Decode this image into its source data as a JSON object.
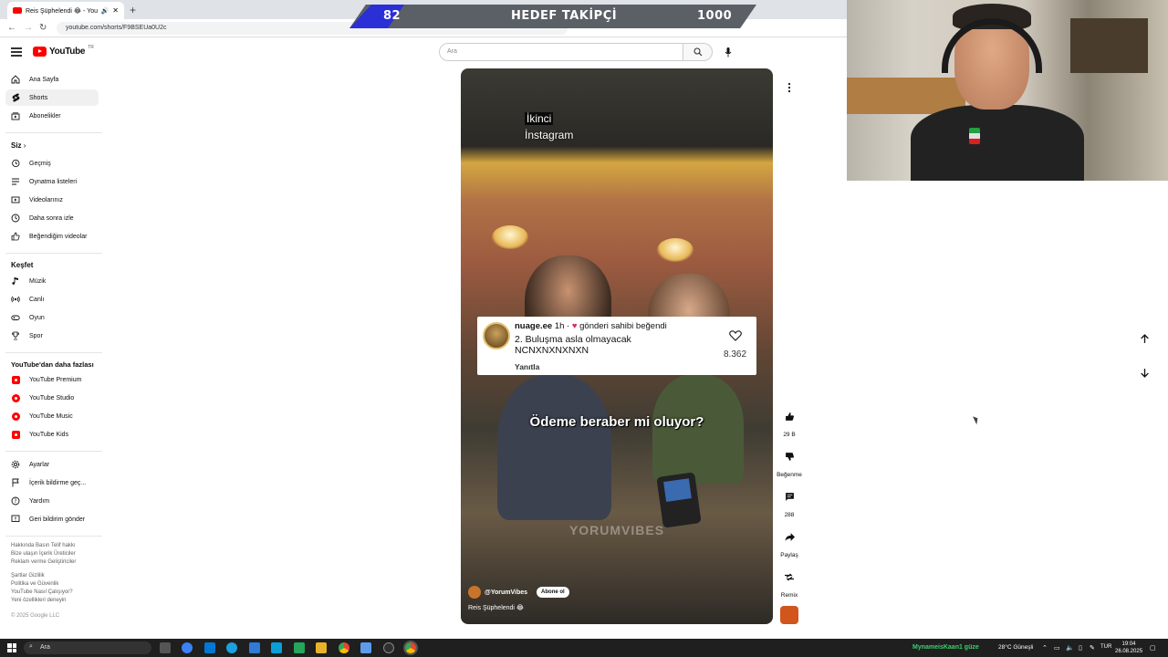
{
  "browser": {
    "tab_title": "Reis Şüphelendi 😂 - YouTube",
    "url": "youtube.com/shorts/F9BSEUa0U2c",
    "new_tab": "+"
  },
  "overlay": {
    "current": "82",
    "label": "HEDEF TAKİPÇİ",
    "target": "1000"
  },
  "header": {
    "logo_text": "YouTube",
    "region": "TR",
    "search_placeholder": "Ara"
  },
  "sidebar": {
    "main": [
      {
        "label": "Ana Sayfa",
        "icon": "home-icon"
      },
      {
        "label": "Shorts",
        "icon": "shorts-icon"
      },
      {
        "label": "Abonelikler",
        "icon": "subscriptions-icon"
      }
    ],
    "you_heading": "Siz",
    "you": [
      {
        "label": "Geçmiş",
        "icon": "history-icon"
      },
      {
        "label": "Oynatma listeleri",
        "icon": "playlist-icon"
      },
      {
        "label": "Videolarınız",
        "icon": "your-videos-icon"
      },
      {
        "label": "Daha sonra izle",
        "icon": "watch-later-icon"
      },
      {
        "label": "Beğendiğim videolar",
        "icon": "liked-icon"
      }
    ],
    "explore_heading": "Keşfet",
    "explore": [
      {
        "label": "Müzik",
        "icon": "music-icon"
      },
      {
        "label": "Canlı",
        "icon": "live-icon"
      },
      {
        "label": "Oyun",
        "icon": "gaming-icon"
      },
      {
        "label": "Spor",
        "icon": "sports-icon"
      }
    ],
    "more_heading": "YouTube'dan daha fazlası",
    "more": [
      {
        "label": "YouTube Premium"
      },
      {
        "label": "YouTube Studio"
      },
      {
        "label": "YouTube Music"
      },
      {
        "label": "YouTube Kids"
      }
    ],
    "settings": [
      {
        "label": "Ayarlar",
        "icon": "settings-icon"
      },
      {
        "label": "İçerik bildirme geç...",
        "icon": "flag-icon"
      },
      {
        "label": "Yardım",
        "icon": "help-icon"
      },
      {
        "label": "Geri bildirim gönder",
        "icon": "feedback-icon"
      }
    ],
    "footer1": "Hakkında  Basın  Telif hakkı\nBize ulaşın  İçerik Üreticiler\nReklam verme  Geliştiriciler",
    "footer2": "Şartlar  Gizlilik\nPolitika ve Güvenlik\nYouTube Nasıl Çalışıyor?\nYeni özellikleri deneyin",
    "copyright": "© 2025 Google LLC"
  },
  "video": {
    "top_caption_1": "İkinci",
    "top_caption_2": "İnstagram",
    "comment": {
      "user": "nuage.ee",
      "time": "1h",
      "liked_by": "gönderi sahibi beğendi",
      "text": "2. Buluşma asla olmayacak NCNXNXNXNXN",
      "reply": "Yanıtla",
      "likes": "8.362"
    },
    "mid_caption": "Ödeme beraber mi oluyor?",
    "watermark": "YORUMVIBES",
    "channel": "@YorumVibes",
    "subscribe": "Abone ol",
    "title": "Reis Şüphelendi 😂"
  },
  "actions": {
    "like_count": "29 B",
    "dislike": "Beğenme",
    "comments": "288",
    "share": "Paylaş",
    "remix": "Remix"
  },
  "taskbar": {
    "search": "Ara",
    "user": "MynameisKaan1 güze",
    "temp": "28°C",
    "weather": "Güneşli",
    "lang": "TUR",
    "time": "19:04",
    "date": "26.08.2025"
  },
  "colors": {
    "youtube_red": "#ff0000",
    "overlay_blue": "#2b2fd6",
    "overlay_gray": "#5b5f66"
  }
}
